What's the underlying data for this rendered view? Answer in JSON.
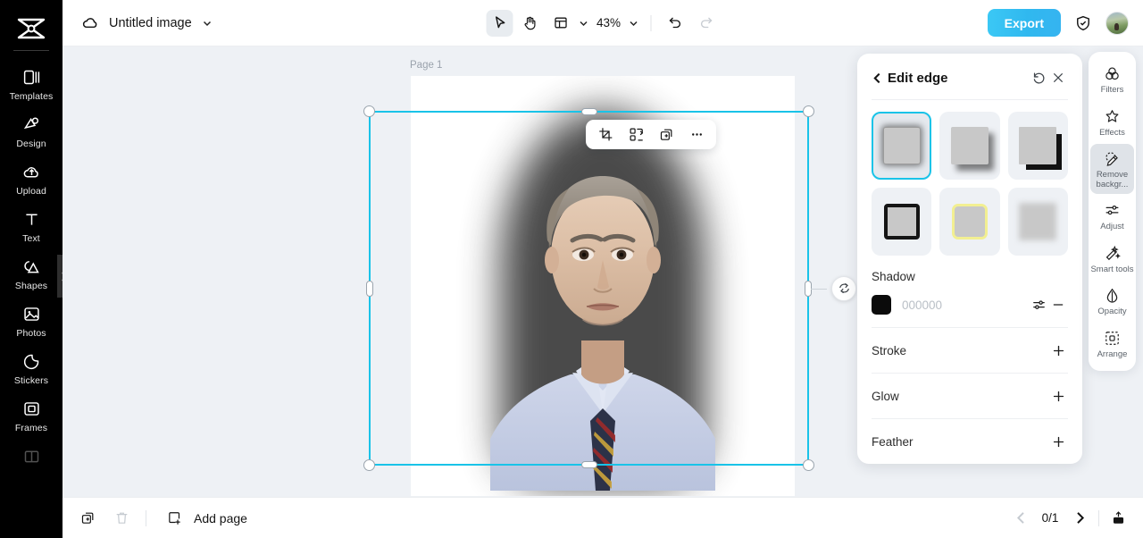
{
  "sidebar": {
    "logo_icon": "capcut-logo-icon",
    "items": [
      {
        "label": "Templates",
        "icon": "templates-icon"
      },
      {
        "label": "Design",
        "icon": "design-icon"
      },
      {
        "label": "Upload",
        "icon": "upload-cloud-icon"
      },
      {
        "label": "Text",
        "icon": "text-icon"
      },
      {
        "label": "Shapes",
        "icon": "shapes-icon"
      },
      {
        "label": "Photos",
        "icon": "photos-icon"
      },
      {
        "label": "Stickers",
        "icon": "stickers-icon"
      },
      {
        "label": "Frames",
        "icon": "frames-icon"
      },
      {
        "label": "",
        "icon": "layout-icon"
      }
    ],
    "collapse_icon": "chevron-right-icon"
  },
  "topbar": {
    "cloud_icon": "cloud-saved-icon",
    "document_title": "Untitled image",
    "title_caret_icon": "chevron-down-icon",
    "tools": [
      {
        "name": "select-tool",
        "icon": "cursor-arrow-icon",
        "active": true
      },
      {
        "name": "hand-tool",
        "icon": "hand-icon",
        "active": false
      },
      {
        "name": "layout-tool",
        "icon": "page-layout-icon",
        "active": false
      }
    ],
    "layout_caret_icon": "chevron-down-icon",
    "zoom_level": "43%",
    "zoom_caret_icon": "chevron-down-icon",
    "undo_icon": "undo-icon",
    "redo_icon": "redo-icon",
    "export_label": "Export",
    "shield_icon": "shield-check-icon",
    "avatar_icon": "user-avatar"
  },
  "canvas": {
    "page_label": "Page 1",
    "context_toolbar": [
      {
        "name": "crop-button",
        "icon": "crop-icon"
      },
      {
        "name": "transform-button",
        "icon": "transform-icon"
      },
      {
        "name": "duplicate-button",
        "icon": "duplicate-icon"
      },
      {
        "name": "more-options-button",
        "icon": "ellipsis-icon"
      }
    ],
    "rotate_icon": "rotate-icon",
    "selection_color": "#19c3e8"
  },
  "edge_panel": {
    "back_icon": "chevron-left-icon",
    "title": "Edit edge",
    "reset_icon": "reset-icon",
    "close_icon": "close-icon",
    "presets": [
      {
        "name": "edge-preset-glow-shadow",
        "selected": true
      },
      {
        "name": "edge-preset-drop-shadow",
        "selected": false
      },
      {
        "name": "edge-preset-hard-shadow",
        "selected": false
      },
      {
        "name": "edge-preset-black-stroke",
        "selected": false
      },
      {
        "name": "edge-preset-yellow-stroke",
        "selected": false
      },
      {
        "name": "edge-preset-feather",
        "selected": false
      }
    ],
    "shadow": {
      "label": "Shadow",
      "color": "#000000",
      "hex_value": "000000",
      "settings_icon": "sliders-icon",
      "remove_icon": "minus-icon"
    },
    "sections": [
      {
        "label": "Stroke",
        "action_icon": "plus-icon"
      },
      {
        "label": "Glow",
        "action_icon": "plus-icon"
      },
      {
        "label": "Feather",
        "action_icon": "plus-icon"
      }
    ]
  },
  "right_rail": {
    "items": [
      {
        "label": "Filters",
        "icon": "filters-icon",
        "active": false
      },
      {
        "label": "Effects",
        "icon": "effects-icon",
        "active": false
      },
      {
        "label": "Remove backgr...",
        "icon": "remove-background-icon",
        "active": true
      },
      {
        "label": "Adjust",
        "icon": "adjust-icon",
        "active": false
      },
      {
        "label": "Smart tools",
        "icon": "smart-tools-icon",
        "active": false
      },
      {
        "label": "Opacity",
        "icon": "opacity-icon",
        "active": false
      },
      {
        "label": "Arrange",
        "icon": "arrange-icon",
        "active": false
      }
    ]
  },
  "bottombar": {
    "duplicate_page_icon": "duplicate-page-icon",
    "delete_page_icon": "trash-icon",
    "add_page_icon": "add-page-icon",
    "add_page_label": "Add page",
    "prev_icon": "chevron-left-icon",
    "page_indicator": "0/1",
    "next_icon": "chevron-right-icon",
    "present_icon": "present-icon"
  }
}
